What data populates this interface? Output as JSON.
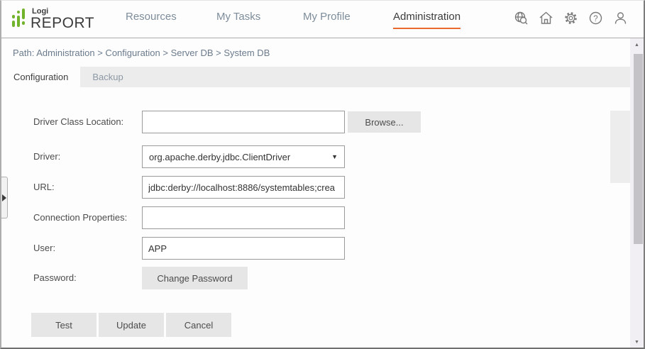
{
  "header": {
    "logo": {
      "top": "Logi",
      "bottom": "REPORT",
      "green": "#72b32c"
    },
    "nav": [
      {
        "label": "Resources",
        "active": false
      },
      {
        "label": "My Tasks",
        "active": false
      },
      {
        "label": "My Profile",
        "active": false
      },
      {
        "label": "Administration",
        "active": true
      }
    ],
    "icons": [
      {
        "name": "search-globe-icon"
      },
      {
        "name": "home-icon"
      },
      {
        "name": "gear-icon"
      },
      {
        "name": "help-icon"
      },
      {
        "name": "user-icon"
      }
    ],
    "help_glyph": "?"
  },
  "breadcrumb": {
    "text": "Path: Administration > Configuration > Server DB > System DB"
  },
  "tabs": [
    {
      "label": "Configuration",
      "active": true
    },
    {
      "label": "Backup",
      "active": false
    }
  ],
  "form": {
    "driver_class_location": {
      "label": "Driver Class Location:",
      "value": "",
      "button": "Browse..."
    },
    "driver": {
      "label": "Driver:",
      "value": "org.apache.derby.jdbc.ClientDriver"
    },
    "url": {
      "label": "URL:",
      "value": "jdbc:derby://localhost:8886/systemtables;crea"
    },
    "connection_properties": {
      "label": "Connection Properties:",
      "value": ""
    },
    "user": {
      "label": "User:",
      "value": "APP"
    },
    "password": {
      "label": "Password:",
      "button": "Change Password"
    },
    "actions": {
      "test": "Test",
      "update": "Update",
      "cancel": "Cancel"
    }
  },
  "glyphs": {
    "caret_down": "▼",
    "scroll_up": "▲",
    "scroll_down": "▼"
  },
  "colors": {
    "accent_orange": "#e8692d",
    "logo_green": "#72b32c",
    "tab_gray": "#ececec"
  }
}
